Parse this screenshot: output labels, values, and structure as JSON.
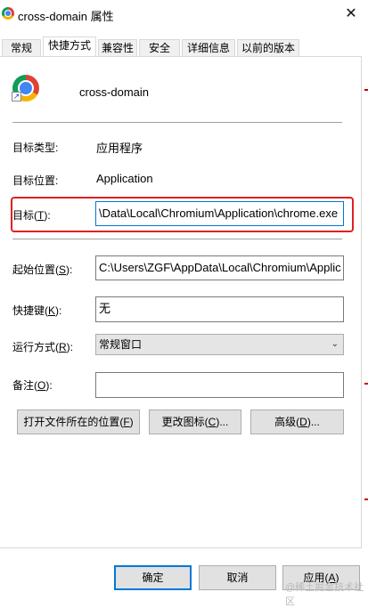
{
  "window": {
    "title": "cross-domain 属性",
    "close_glyph": "✕"
  },
  "tabs": [
    {
      "label": "常规"
    },
    {
      "label": "快捷方式"
    },
    {
      "label": "兼容性"
    },
    {
      "label": "安全"
    },
    {
      "label": "详细信息"
    },
    {
      "label": "以前的版本"
    }
  ],
  "active_tab": "快捷方式",
  "header": {
    "shortcut_name": "cross-domain",
    "icon": "chromium-icon"
  },
  "fields": {
    "target_type_label": "目标类型:",
    "target_type_value": "应用程序",
    "target_location_label": "目标位置:",
    "target_location_value": "Application",
    "target_label_pre": "目标(",
    "target_label_key": "T",
    "target_label_post": "):",
    "target_value": "\\Data\\Local\\Chromium\\Application\\chrome.exe",
    "start_in_label_pre": "起始位置(",
    "start_in_label_key": "S",
    "start_in_label_post": "):",
    "start_in_value": "C:\\Users\\ZGF\\AppData\\Local\\Chromium\\Applic",
    "hotkey_label_pre": "快捷键(",
    "hotkey_label_key": "K",
    "hotkey_label_post": "):",
    "hotkey_value": "无",
    "run_label_pre": "运行方式(",
    "run_label_key": "R",
    "run_label_post": "):",
    "run_value": "常规窗口",
    "comment_label_pre": "备注(",
    "comment_label_key": "O",
    "comment_label_post": "):",
    "comment_value": ""
  },
  "action_buttons": {
    "open_location_pre": "打开文件所在的位置(",
    "open_location_key": "F",
    "open_location_post": ")",
    "change_icon_pre": "更改图标(",
    "change_icon_key": "C",
    "change_icon_post": ")...",
    "advanced_pre": "高级(",
    "advanced_key": "D",
    "advanced_post": ")..."
  },
  "footer": {
    "ok": "确定",
    "cancel": "取消",
    "apply_pre": "应用(",
    "apply_key": "A",
    "apply_post": ")"
  },
  "watermark": "@稀土掘金技术社区",
  "colors": {
    "highlight": "#e02020",
    "focus": "#0078d7"
  }
}
